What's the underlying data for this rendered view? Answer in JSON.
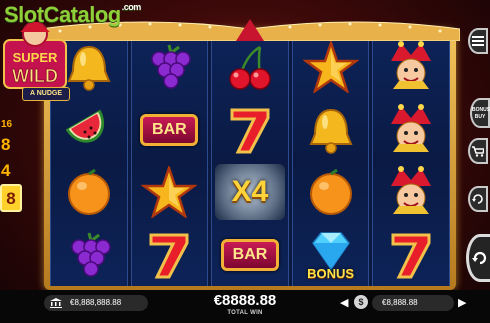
{
  "watermark": {
    "name": "SlotCatalog",
    "tld": ".com"
  },
  "logo": {
    "badge": "A NUDGE"
  },
  "multipliers": {
    "items": [
      "16",
      "8",
      "4",
      "8"
    ],
    "active_index": 3
  },
  "reels": [
    [
      "bell",
      "grapes",
      "cherries",
      "star",
      "jester"
    ],
    [
      "watermelon",
      "bar",
      "seven",
      "bell",
      "jester"
    ],
    [
      "orange",
      "star",
      "x4",
      "orange",
      "jester"
    ],
    [
      "grapes",
      "seven",
      "bar",
      "diamond-bonus",
      "seven"
    ]
  ],
  "symbols": {
    "bar_label": "BAR",
    "x4_label": "X4",
    "bonus_label": "BONUS"
  },
  "side_buttons": {
    "bonus_buy_label": "BONUS BUY"
  },
  "bottom": {
    "balance": "€8,888,888.88",
    "win_value": "€8888.88",
    "win_label": "TOTAL WIN",
    "bet": "€8,888.88"
  },
  "colors": {
    "reel_bg": "#0d2358",
    "frame_gold": "#f3c45b",
    "bg_red": "#7a1a14"
  }
}
